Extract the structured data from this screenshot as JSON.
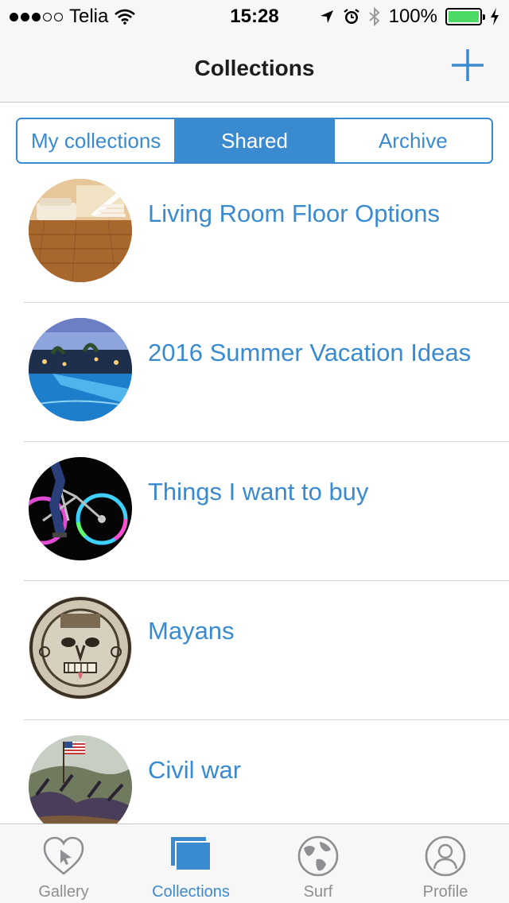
{
  "status_bar": {
    "carrier": "Telia",
    "time": "15:28",
    "battery": "100%",
    "signal_bars_filled": 3,
    "signal_bars_total": 5,
    "battery_level": 1.0
  },
  "nav": {
    "title": "Collections",
    "add_icon": "plus-icon"
  },
  "segments": [
    {
      "label": "My collections",
      "active": false
    },
    {
      "label": "Shared",
      "active": true
    },
    {
      "label": "Archive",
      "active": false
    }
  ],
  "collections": [
    {
      "title": "Living Room Floor Options",
      "thumbnail": "living-room-photo"
    },
    {
      "title": "2016 Summer Vacation Ideas",
      "thumbnail": "resort-pool-photo"
    },
    {
      "title": "Things I want to buy",
      "thumbnail": "led-bike-wheel-photo"
    },
    {
      "title": "Mayans",
      "thumbnail": "mayan-mask-photo"
    },
    {
      "title": "Civil war",
      "thumbnail": "civil-war-painting"
    }
  ],
  "tabs": [
    {
      "label": "Gallery",
      "icon": "heart-cursor-icon",
      "active": false
    },
    {
      "label": "Collections",
      "icon": "collections-icon",
      "active": true
    },
    {
      "label": "Surf",
      "icon": "globe-icon",
      "active": false
    },
    {
      "label": "Profile",
      "icon": "profile-icon",
      "active": false
    }
  ],
  "colors": {
    "accent": "#3a8ad0",
    "battery_green": "#4cd964",
    "inactive": "#8e8e93"
  }
}
